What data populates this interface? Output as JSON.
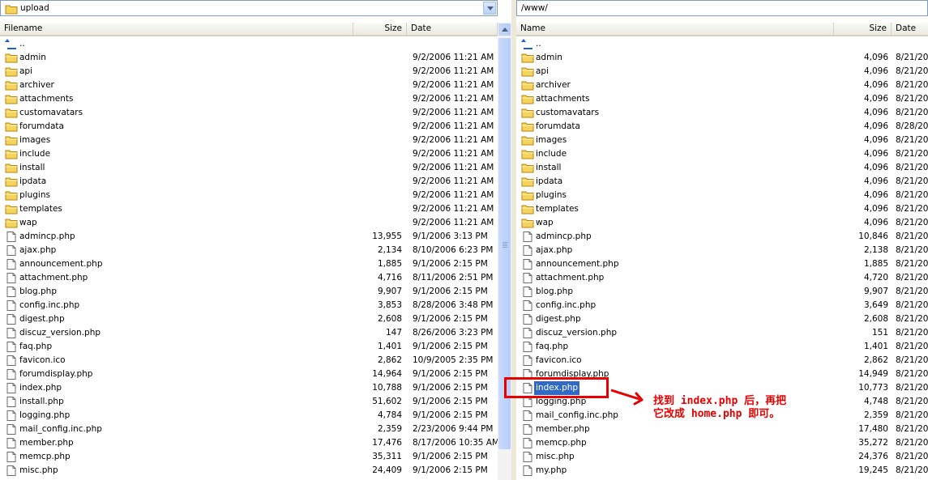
{
  "left": {
    "path": "upload",
    "headers": {
      "name": "Filename",
      "size": "Size",
      "date": "Date"
    },
    "parent": "..",
    "rows": [
      {
        "type": "folder",
        "name": "admin",
        "size": "",
        "date": "9/2/2006 11:21 AM"
      },
      {
        "type": "folder",
        "name": "api",
        "size": "",
        "date": "9/2/2006 11:21 AM"
      },
      {
        "type": "folder",
        "name": "archiver",
        "size": "",
        "date": "9/2/2006 11:21 AM"
      },
      {
        "type": "folder",
        "name": "attachments",
        "size": "",
        "date": "9/2/2006 11:21 AM"
      },
      {
        "type": "folder",
        "name": "customavatars",
        "size": "",
        "date": "9/2/2006 11:21 AM"
      },
      {
        "type": "folder",
        "name": "forumdata",
        "size": "",
        "date": "9/2/2006 11:21 AM"
      },
      {
        "type": "folder",
        "name": "images",
        "size": "",
        "date": "9/2/2006 11:21 AM"
      },
      {
        "type": "folder",
        "name": "include",
        "size": "",
        "date": "9/2/2006 11:21 AM"
      },
      {
        "type": "folder",
        "name": "install",
        "size": "",
        "date": "9/2/2006 11:21 AM"
      },
      {
        "type": "folder",
        "name": "ipdata",
        "size": "",
        "date": "9/2/2006 11:21 AM"
      },
      {
        "type": "folder",
        "name": "plugins",
        "size": "",
        "date": "9/2/2006 11:21 AM"
      },
      {
        "type": "folder",
        "name": "templates",
        "size": "",
        "date": "9/2/2006 11:21 AM"
      },
      {
        "type": "folder",
        "name": "wap",
        "size": "",
        "date": "9/2/2006 11:21 AM"
      },
      {
        "type": "file",
        "name": "admincp.php",
        "size": "13,955",
        "date": "9/1/2006 3:13 PM"
      },
      {
        "type": "file",
        "name": "ajax.php",
        "size": "2,134",
        "date": "8/10/2006 6:23 PM"
      },
      {
        "type": "file",
        "name": "announcement.php",
        "size": "1,885",
        "date": "9/1/2006 2:15 PM"
      },
      {
        "type": "file",
        "name": "attachment.php",
        "size": "4,716",
        "date": "8/11/2006 2:51 PM"
      },
      {
        "type": "file",
        "name": "blog.php",
        "size": "9,907",
        "date": "9/1/2006 2:15 PM"
      },
      {
        "type": "file",
        "name": "config.inc.php",
        "size": "3,853",
        "date": "8/28/2006 3:48 PM"
      },
      {
        "type": "file",
        "name": "digest.php",
        "size": "2,608",
        "date": "9/1/2006 2:15 PM"
      },
      {
        "type": "file",
        "name": "discuz_version.php",
        "size": "147",
        "date": "8/26/2006 3:23 PM"
      },
      {
        "type": "file",
        "name": "faq.php",
        "size": "1,401",
        "date": "9/1/2006 2:15 PM"
      },
      {
        "type": "file",
        "name": "favicon.ico",
        "size": "2,862",
        "date": "10/9/2005 2:35 PM"
      },
      {
        "type": "file",
        "name": "forumdisplay.php",
        "size": "14,964",
        "date": "9/1/2006 2:15 PM"
      },
      {
        "type": "file",
        "name": "index.php",
        "size": "10,788",
        "date": "9/1/2006 2:15 PM"
      },
      {
        "type": "file",
        "name": "install.php",
        "size": "51,602",
        "date": "9/1/2006 2:15 PM"
      },
      {
        "type": "file",
        "name": "logging.php",
        "size": "4,784",
        "date": "9/1/2006 2:15 PM"
      },
      {
        "type": "file",
        "name": "mail_config.inc.php",
        "size": "2,359",
        "date": "2/23/2006 9:44 PM"
      },
      {
        "type": "file",
        "name": "member.php",
        "size": "17,476",
        "date": "8/17/2006 10:35 AM"
      },
      {
        "type": "file",
        "name": "memcp.php",
        "size": "35,311",
        "date": "9/1/2006 2:15 PM"
      },
      {
        "type": "file",
        "name": "misc.php",
        "size": "24,409",
        "date": "9/1/2006 2:15 PM"
      }
    ]
  },
  "right": {
    "path": "/www/",
    "headers": {
      "name": "Name",
      "size": "Size",
      "date": "Date"
    },
    "parent": "..",
    "rows": [
      {
        "type": "folder",
        "name": "admin",
        "size": "4,096",
        "date": "8/21/20"
      },
      {
        "type": "folder",
        "name": "api",
        "size": "4,096",
        "date": "8/21/20"
      },
      {
        "type": "folder",
        "name": "archiver",
        "size": "4,096",
        "date": "8/21/20"
      },
      {
        "type": "folder",
        "name": "attachments",
        "size": "4,096",
        "date": "8/21/20"
      },
      {
        "type": "folder",
        "name": "customavatars",
        "size": "4,096",
        "date": "8/21/20"
      },
      {
        "type": "folder",
        "name": "forumdata",
        "size": "4,096",
        "date": "8/28/20"
      },
      {
        "type": "folder",
        "name": "images",
        "size": "4,096",
        "date": "8/21/20"
      },
      {
        "type": "folder",
        "name": "include",
        "size": "4,096",
        "date": "8/21/20"
      },
      {
        "type": "folder",
        "name": "install",
        "size": "4,096",
        "date": "8/21/20"
      },
      {
        "type": "folder",
        "name": "ipdata",
        "size": "4,096",
        "date": "8/21/20"
      },
      {
        "type": "folder",
        "name": "plugins",
        "size": "4,096",
        "date": "8/21/20"
      },
      {
        "type": "folder",
        "name": "templates",
        "size": "4,096",
        "date": "8/21/20"
      },
      {
        "type": "folder",
        "name": "wap",
        "size": "4,096",
        "date": "8/21/20"
      },
      {
        "type": "file",
        "name": "admincp.php",
        "size": "10,846",
        "date": "8/21/20"
      },
      {
        "type": "file",
        "name": "ajax.php",
        "size": "2,138",
        "date": "8/21/20"
      },
      {
        "type": "file",
        "name": "announcement.php",
        "size": "1,885",
        "date": "8/21/20"
      },
      {
        "type": "file",
        "name": "attachment.php",
        "size": "4,720",
        "date": "8/21/20"
      },
      {
        "type": "file",
        "name": "blog.php",
        "size": "9,907",
        "date": "8/21/20"
      },
      {
        "type": "file",
        "name": "config.inc.php",
        "size": "3,649",
        "date": "8/21/20"
      },
      {
        "type": "file",
        "name": "digest.php",
        "size": "2,608",
        "date": "8/21/20"
      },
      {
        "type": "file",
        "name": "discuz_version.php",
        "size": "151",
        "date": "8/21/20"
      },
      {
        "type": "file",
        "name": "faq.php",
        "size": "1,401",
        "date": "8/21/20"
      },
      {
        "type": "file",
        "name": "favicon.ico",
        "size": "2,862",
        "date": "8/21/20"
      },
      {
        "type": "file",
        "name": "forumdisplay.php",
        "size": "14,949",
        "date": "8/21/20"
      },
      {
        "type": "file",
        "name": "index.php",
        "size": "10,773",
        "date": "8/21/20",
        "selected": true
      },
      {
        "type": "file",
        "name": "logging.php",
        "size": "4,748",
        "date": "8/21/20"
      },
      {
        "type": "file",
        "name": "mail_config.inc.php",
        "size": "2,359",
        "date": "8/21/20"
      },
      {
        "type": "file",
        "name": "member.php",
        "size": "17,480",
        "date": "8/21/20"
      },
      {
        "type": "file",
        "name": "memcp.php",
        "size": "35,272",
        "date": "8/21/20"
      },
      {
        "type": "file",
        "name": "misc.php",
        "size": "24,376",
        "date": "8/21/20"
      },
      {
        "type": "file",
        "name": "my.php",
        "size": "19,245",
        "date": "8/21/20"
      }
    ]
  },
  "annotation": {
    "line1": "找到 index.php 后，再把",
    "line2": "它改成 home.php 即可。",
    "color": "#e60000"
  },
  "icons": {
    "folder": "folder-icon",
    "file": "file-icon",
    "parent": "parent-directory-icon"
  }
}
